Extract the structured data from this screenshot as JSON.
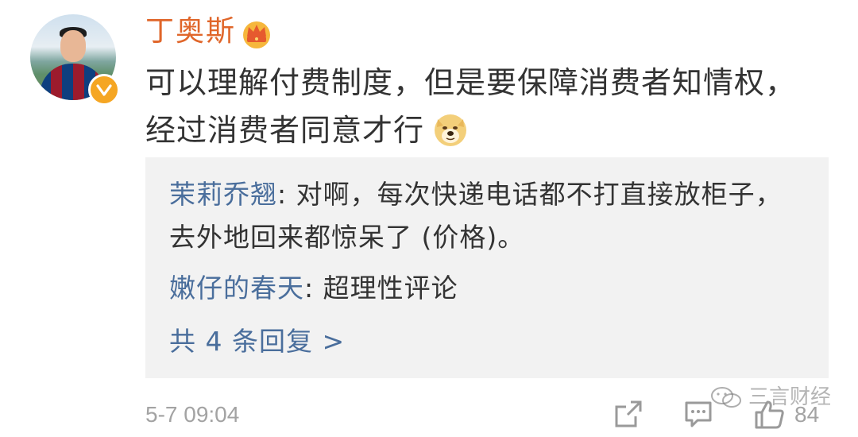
{
  "comment": {
    "username": "丁奥斯",
    "text_line1": "可以理解付费制度，但是要保障消费者知情权，",
    "text_line2": "经过消费者同意才行",
    "emoji_icon": "doge-emoji-icon",
    "timestamp": "5-7 09:04",
    "like_count": "84",
    "crown_icon": "vip-crown-icon",
    "verified_icon": "verified-badge-icon"
  },
  "replies": [
    {
      "author": "茉莉乔翘",
      "separator": ": ",
      "text": "对啊，每次快递电话都不打直接放柜子，去外地回来都惊呆了 (价格)。"
    },
    {
      "author": "嫩仔的春天",
      "separator": ": ",
      "text": "超理性评论"
    }
  ],
  "more_replies_label": "共 4 条回复 >",
  "watermark": {
    "text": "三言财经",
    "icon": "wechat-icon"
  },
  "colors": {
    "username": "#e0662a",
    "reply_author": "#4a6e9c",
    "reply_bg": "#f2f2f2",
    "meta_text": "#a3a3a3",
    "badge": "#f5a623"
  }
}
